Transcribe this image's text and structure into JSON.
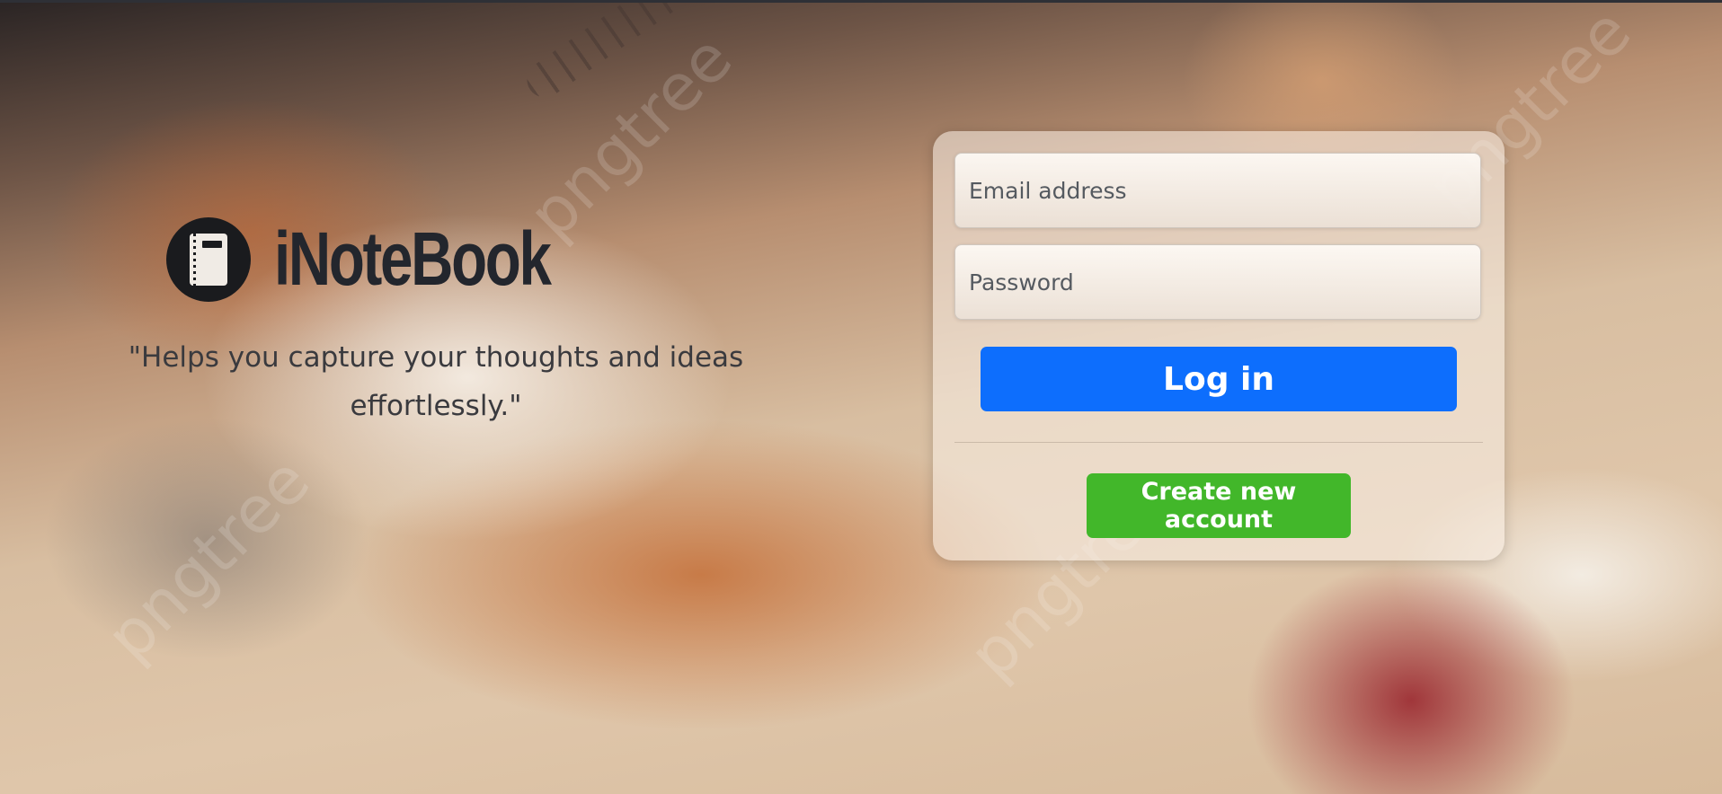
{
  "brand": {
    "name": "iNoteBook",
    "tagline": "\"Helps you capture your thoughts and ideas effortlessly.\""
  },
  "login": {
    "email_placeholder": "Email address",
    "password_placeholder": "Password",
    "login_label": "Log in",
    "create_account_label": "Create new account"
  },
  "watermark": "pngtree",
  "colors": {
    "login_button": "#0d6efd",
    "create_button": "#42b72a",
    "brand_text": "#23262d"
  },
  "icons": {
    "logo": "notebook-icon"
  }
}
